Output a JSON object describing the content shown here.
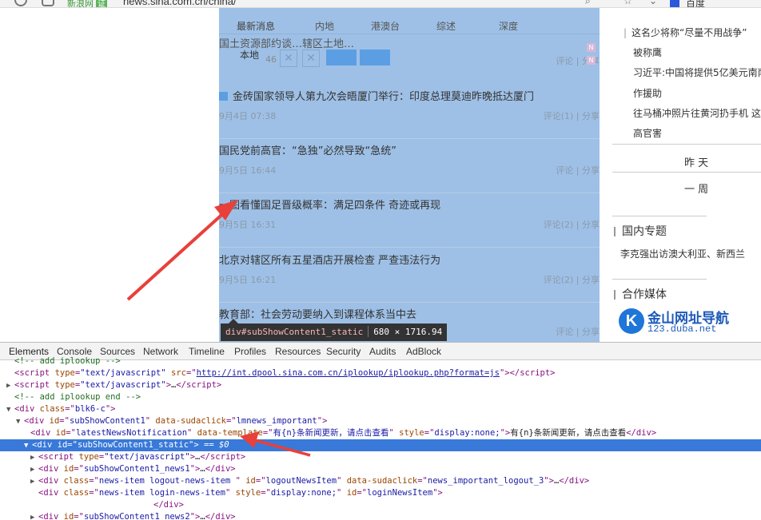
{
  "browser": {
    "url_badge": "新浪网",
    "url_cert": "证",
    "url": "news.sina.com.cn/china/",
    "search_engine": "百度"
  },
  "tabs": [
    "最新消息",
    "内地",
    "港澳台",
    "综述",
    "深度"
  ],
  "fragment": {
    "clipped_title": "国土资源部约谈…辖区土地…",
    "local_label": "本地",
    "local_num": "46"
  },
  "news": [
    {
      "title": "金砖国家领导人第九次会晤厦门举行：印度总理莫迪昨晚抵达厦门",
      "time": "9月4日 07:38",
      "comments": "评论(1) | 分享",
      "icon": true
    },
    {
      "title": "国民党前高官：“急独”必然导致“急统”",
      "time": "9月5日 16:44",
      "comments": "评论 | 分享",
      "icon": false
    },
    {
      "title": "一图看懂国足晋级概率：满足四条件 奇迹或再现",
      "time": "9月5日 16:31",
      "comments": "评论(2) | 分享",
      "icon": false
    },
    {
      "title": "北京对辖区所有五星酒店开展检查 严查违法行为",
      "time": "9月5日 16:21",
      "comments": "评论(2) | 分享",
      "icon": false
    },
    {
      "title": "教育部：社会劳动要纳入到课程体系当中去",
      "time": "",
      "comments": "评论 | 分享",
      "icon": false
    }
  ],
  "fragment_comments": "评论 | 分享",
  "right_col": {
    "items": [
      "这名少将称“尽量不用战争”",
      "被称鹰",
      "习近平:中国将提供5亿美元南南",
      "作援助",
      "往马桶冲照片往黄河扔手机 这",
      "高官害"
    ],
    "period_yesterday": "昨 天",
    "period_week": "一 周",
    "section_domestic": "国内专题",
    "domestic_item": "李克强出访澳大利亚、新西兰",
    "section_media": "合作媒体",
    "logo_brand": "金山网址导航",
    "logo_sub": "123.duba.net",
    "logo_letter": "K"
  },
  "tooltip": {
    "selector": "div#subShowContent1_static",
    "size": "680 × 1716.94"
  },
  "devtools": {
    "tabs": [
      "Elements",
      "Console",
      "Sources",
      "Network",
      "Timeline",
      "Profiles",
      "Resources",
      "Security",
      "Audits",
      "AdBlock"
    ],
    "lines": {
      "l0": "<!-- add iplookup -->",
      "l1_src": "http://int.dpool.sina.com.cn/iplookup/iplookup.php?format=js",
      "l3": "<!-- add iplookup end -->",
      "l4_class": "blk6-c",
      "l5_id": "subShowContent1",
      "l5_attr": "lmnews_important",
      "l6_id": "latestNewsNotification",
      "l6_tpl": "有{n}条新闻更新，请点击查看",
      "l6_style": "display:none;",
      "l6_text": "有{n}条新闻更新，请点击查看",
      "l7_id": "subShowContent1_static",
      "l7_eq": "== $0",
      "l9_id": "subShowContent1_news1",
      "l10_class": "news-item logout-news-item ",
      "l10_id": "logoutNewsItem",
      "l10_attr": "news_important_logout_3",
      "l11_class": "news-item login-news-item",
      "l11_style": "display:none;",
      "l11_id": "loginNewsItem",
      "l13_id": "subShowContent1_news2"
    }
  }
}
